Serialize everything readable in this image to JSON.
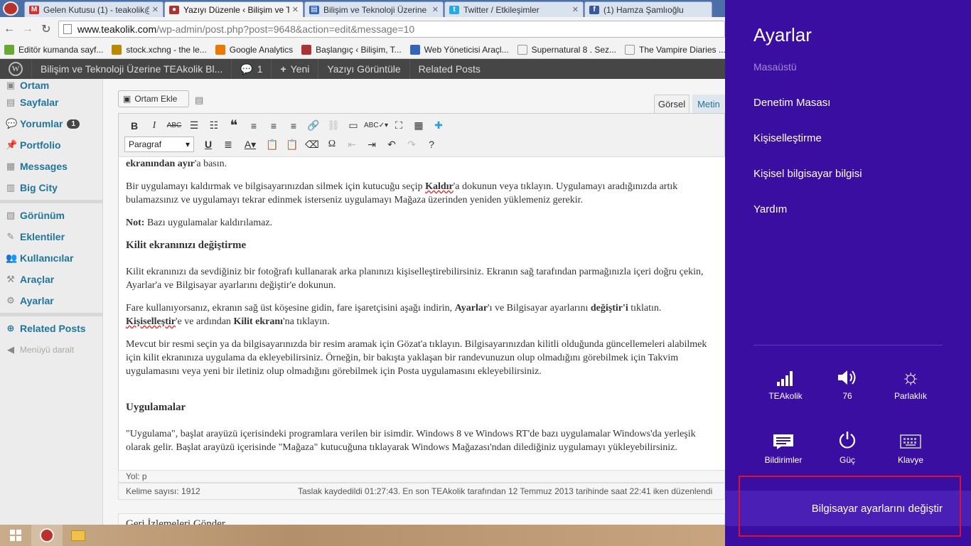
{
  "browser": {
    "tabs": [
      {
        "label": "Gelen Kutusu (1) - teakolik@",
        "favicon": "gmail-icon",
        "color": "#c33"
      },
      {
        "label": "Yazıyı Düzenle ‹ Bilişim ve Te",
        "favicon": "site-icon",
        "color": "#a33",
        "active": true
      },
      {
        "label": "Bilişim ve Teknoloji Üzerine",
        "favicon": "doc-icon",
        "color": "#36b"
      },
      {
        "label": "Twitter / Etkileşimler",
        "favicon": "twitter-icon",
        "color": "#2aa9e0"
      },
      {
        "label": "(1) Hamza Şamlıoğlu",
        "favicon": "facebook-icon",
        "color": "#3b5998"
      }
    ],
    "url_host": "www.teakolik.com",
    "url_path": "/wp-admin/post.php?post=9648&action=edit&message=10",
    "bookmarks": [
      {
        "label": "Editör kumanda sayf...",
        "color": "#6a3"
      },
      {
        "label": "stock.xchng - the le...",
        "color": "#b80"
      },
      {
        "label": "Google Analytics",
        "color": "#e70"
      },
      {
        "label": "Başlangıç ‹ Bilişim, T...",
        "color": "#a33"
      },
      {
        "label": "Web Yöneticisi Araçl...",
        "color": "#36b"
      },
      {
        "label": "Supernatural 8 . Sez...",
        "color": "#ccc"
      },
      {
        "label": "The Vampire Diaries ...",
        "color": "#ccc"
      }
    ]
  },
  "adminbar": {
    "site_title": "Bilişim ve Teknoloji Üzerine TEAkolik Bl...",
    "comments_count": "1",
    "new_label": "Yeni",
    "view_post": "Yazıyı Görüntüle",
    "related": "Related Posts"
  },
  "sidebar": {
    "items": [
      {
        "label": "Ortam",
        "icon": "media-icon"
      },
      {
        "label": "Sayfalar",
        "icon": "pages-icon"
      },
      {
        "label": "Yorumlar",
        "icon": "comments-icon",
        "badge": "1"
      },
      {
        "label": "Portfolio",
        "icon": "pin-icon"
      },
      {
        "label": "Messages",
        "icon": "messages-icon"
      },
      {
        "label": "Big City",
        "icon": "chart-icon"
      }
    ],
    "items2": [
      {
        "label": "Görünüm",
        "icon": "appearance-icon"
      },
      {
        "label": "Eklentiler",
        "icon": "plugins-icon"
      },
      {
        "label": "Kullanıcılar",
        "icon": "users-icon"
      },
      {
        "label": "Araçlar",
        "icon": "tools-icon"
      },
      {
        "label": "Ayarlar",
        "icon": "settings-icon"
      }
    ],
    "related": "Related Posts",
    "collapse": "Menüyü daralt"
  },
  "editor": {
    "add_media": "Ortam Ekle",
    "tab_visual": "Görsel",
    "tab_text": "Metin",
    "format": "Paragraf",
    "path": "Yol: p",
    "word_count": "Kelime sayısı: 1912",
    "draft_status": "Taslak kaydedildi 01:27:43. En son TEAkolik tarafından 12 Temmuz 2013 tarihinde saat 22:41 iken düzenlendi",
    "trackbacks": "Geri İzlemeleri Gönder"
  },
  "content": {
    "p0_bold": "ekranından ayır",
    "p0_rest": "'a basın.",
    "p1_a": "Bir uygulamayı kaldırmak ve bilgisayarınızdan silmek için kutucuğu seçip ",
    "p1_b": "Kaldır",
    "p1_c": "'a dokunun veya tıklayın. Uygulamayı aradığınızda artık bulamazsınız ve uygulamayı tekrar edinmek isterseniz uygulamayı Mağaza üzerinden yeniden yüklemeniz gerekir.",
    "note_label": "Not:",
    "note_text": " Bazı uygulamalar kaldırılamaz.",
    "h_lock": "Kilit ekranınızı değiştirme",
    "p2": "Kilit ekranınızı da sevdiğiniz bir fotoğrafı kullanarak arka planınızı kişiselleştirebilirsiniz. Ekranın sağ tarafından parmağınızla içeri doğru çekin, Ayarlar'a ve Bilgisayar ayarlarını değiştir'e dokunun.",
    "p3_a": "Fare kullanıyorsanız, ekranın sağ üst köşesine gidin, fare işaretçisini aşağı indirin, ",
    "p3_b": "Ayarlar",
    "p3_c": "'ı ve Bilgisayar ayarlarını ",
    "p3_d": "değiştir'i",
    "p3_e": " tıklatın. ",
    "p3_f": "Kişiselleştir",
    "p3_g": "'e ve ardından ",
    "p3_h": "Kilit ekranı",
    "p3_i": "'na tıklayın.",
    "p4": "Mevcut bir resmi seçin ya da bilgisayarınızda bir resim aramak için Gözat'a tıklayın. Bilgisayarınızdan kilitli olduğunda güncellemeleri alabilmek için kilit ekranınıza uygulama da ekleyebilirsiniz. Örneğin, bir bakışta yaklaşan bir randevunuzun olup olmadığını görebilmek için Takvim uygulamasını veya yeni bir iletiniz olup olmadığını görebilmek için Posta uygulamasını ekleyebilirsiniz.",
    "h_apps": "Uygulamalar",
    "p5": "\"Uygulama\", başlat arayüzü içerisindeki programlara verilen bir isimdir. Windows 8 ve Windows RT'de bazı uygulamalar Windows'da yerleşik olarak gelir. Başlat arayüzü içerisinde \"Mağaza\" kutucuğuna tıklayarak Windows Mağazası'ndan dilediğiniz uygulamayı yükleyebilirsiniz."
  },
  "charms": {
    "title": "Ayarlar",
    "desktop": "Masaüstü",
    "links": [
      "Denetim Masası",
      "Kişiselleştirme",
      "Kişisel bilgisayar bilgisi",
      "Yardım"
    ],
    "network": "TEAkolik",
    "volume": "76",
    "brightness": "Parlaklık",
    "notifications": "Bildirimler",
    "power": "Güç",
    "keyboard": "Klavye",
    "change_pc_settings": "Bilgisayar ayarlarını değiştir"
  }
}
